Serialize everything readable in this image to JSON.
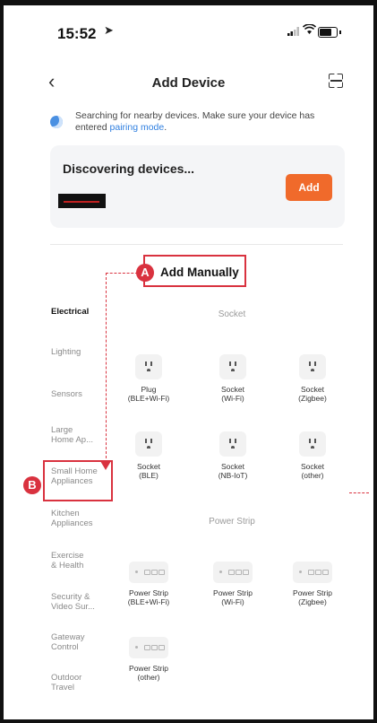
{
  "status_bar": {
    "time": "15:52"
  },
  "nav": {
    "title": "Add Device"
  },
  "search": {
    "text": "Searching for nearby devices. Make sure your device has entered ",
    "link": "pairing mode",
    "after": "."
  },
  "discovery": {
    "title": "Discovering devices...",
    "add_label": "Add"
  },
  "manual": {
    "title": "Add Manually"
  },
  "badges": {
    "a": "A",
    "b": "B"
  },
  "sidebar": {
    "items": [
      {
        "label": "Electrical",
        "active": true
      },
      {
        "label": "Lighting"
      },
      {
        "label": "Sensors"
      },
      {
        "label": "Large\nHome Ap..."
      },
      {
        "label": "Small Home\nAppliances"
      },
      {
        "label": "Kitchen\nAppliances"
      },
      {
        "label": "Exercise\n& Health"
      },
      {
        "label": "Security &\nVideo Sur..."
      },
      {
        "label": "Gateway\nControl"
      },
      {
        "label": "Outdoor\nTravel"
      }
    ]
  },
  "sections": {
    "socket": "Socket",
    "power_strip": "Power Strip"
  },
  "socket_devices": [
    {
      "label": "Plug\n(BLE+Wi-Fi)"
    },
    {
      "label": "Socket\n(Wi-Fi)"
    },
    {
      "label": "Socket\n(Zigbee)"
    },
    {
      "label": "Socket\n(BLE)"
    },
    {
      "label": "Socket\n(NB-IoT)"
    },
    {
      "label": "Socket\n(other)"
    }
  ],
  "strip_devices": [
    {
      "label": "Power Strip\n(BLE+Wi-Fi)"
    },
    {
      "label": "Power Strip\n(Wi-Fi)"
    },
    {
      "label": "Power Strip\n(Zigbee)"
    },
    {
      "label": "Power Strip\n(other)"
    }
  ]
}
